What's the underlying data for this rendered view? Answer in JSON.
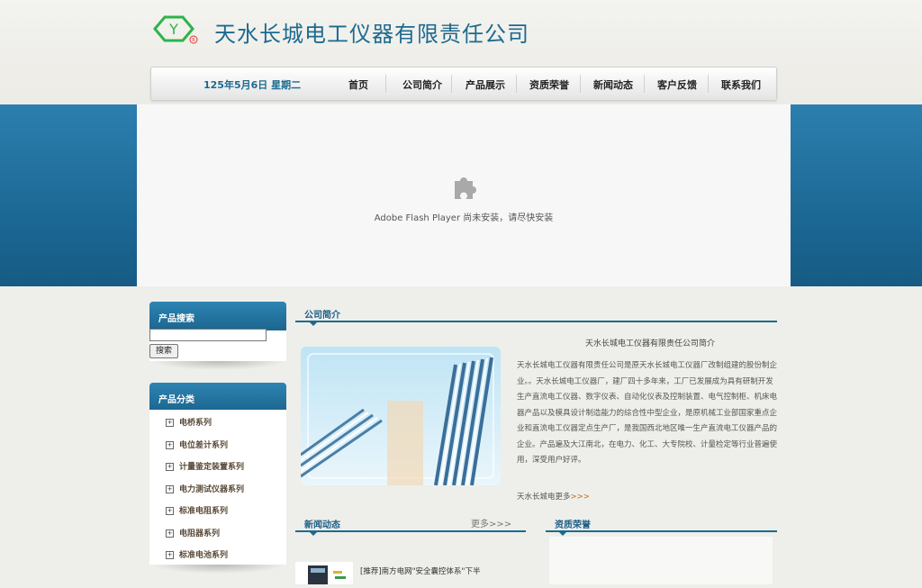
{
  "header": {
    "company_name": "天水长城电工仪器有限责任公司"
  },
  "nav": {
    "date": "125年5月6日 星期二",
    "items": [
      "首页",
      "公司简介",
      "产品展示",
      "资质荣誉",
      "新闻动态",
      "客户反馈",
      "联系我们"
    ]
  },
  "flash": {
    "message": "Adobe Flash Player 尚未安装，请尽快安装"
  },
  "sidebar": {
    "search_title": "产品搜索",
    "search_value": "",
    "search_button": "搜索",
    "category_title": "产品分类",
    "categories": [
      "电桥系列",
      "电位差计系列",
      "计量鉴定装置系列",
      "电力测试仪器系列",
      "标准电阻系列",
      "电阻器系列",
      "标准电池系列"
    ]
  },
  "about": {
    "title": "公司简介",
    "heading": "天水长城电工仪器有限责任公司简介",
    "text": "天水长城电工仪器有限责任公司是原天水长城电工仪器厂改制组建的股份制企业。。天水长城电工仪器厂，建厂四十多年来，工厂已发展成为具有研制开发生产直流电工仪器、数字仪表、自动化仪表及控制装置、电气控制柜、机床电器产品以及模具设计制造能力的综合性中型企业，是原机械工业部国家重点企业和直流电工仪器定点生产厂，是我国西北地区唯一生产直流电工仪器产品的企业。产品遍及大江南北，在电力、化工、大专院校、计量检定等行业普遍使用，深受用户好评。",
    "more_label": "天水长城电更多",
    "more_arrows": ">>>"
  },
  "news": {
    "title": "新闻动态",
    "more": "更多>>>",
    "items": [
      "[推荐]南方电网\"安全囊控体系\"下半"
    ]
  },
  "honors": {
    "title": "资质荣誉"
  },
  "colors": {
    "brand_blue": "#1d6a90",
    "band_blue": "#1a6591",
    "more_orange": "#c0701c"
  }
}
